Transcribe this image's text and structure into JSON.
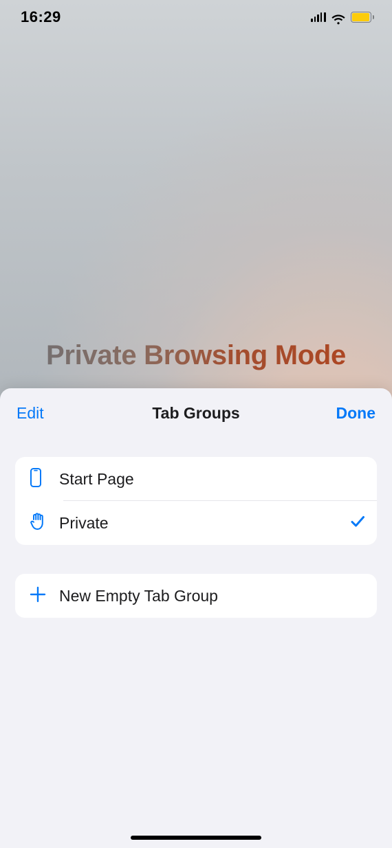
{
  "status": {
    "time": "16:29"
  },
  "background": {
    "private_mode_label": "Private Browsing Mode"
  },
  "sheet": {
    "edit_label": "Edit",
    "title": "Tab Groups",
    "done_label": "Done",
    "groups": [
      {
        "icon": "phone-icon",
        "label": "Start Page",
        "selected": false
      },
      {
        "icon": "hand-icon",
        "label": "Private",
        "selected": true
      }
    ],
    "new_group_label": "New Empty Tab Group"
  },
  "colors": {
    "ios_blue": "#007aff",
    "battery_yellow": "#ffcc00"
  }
}
